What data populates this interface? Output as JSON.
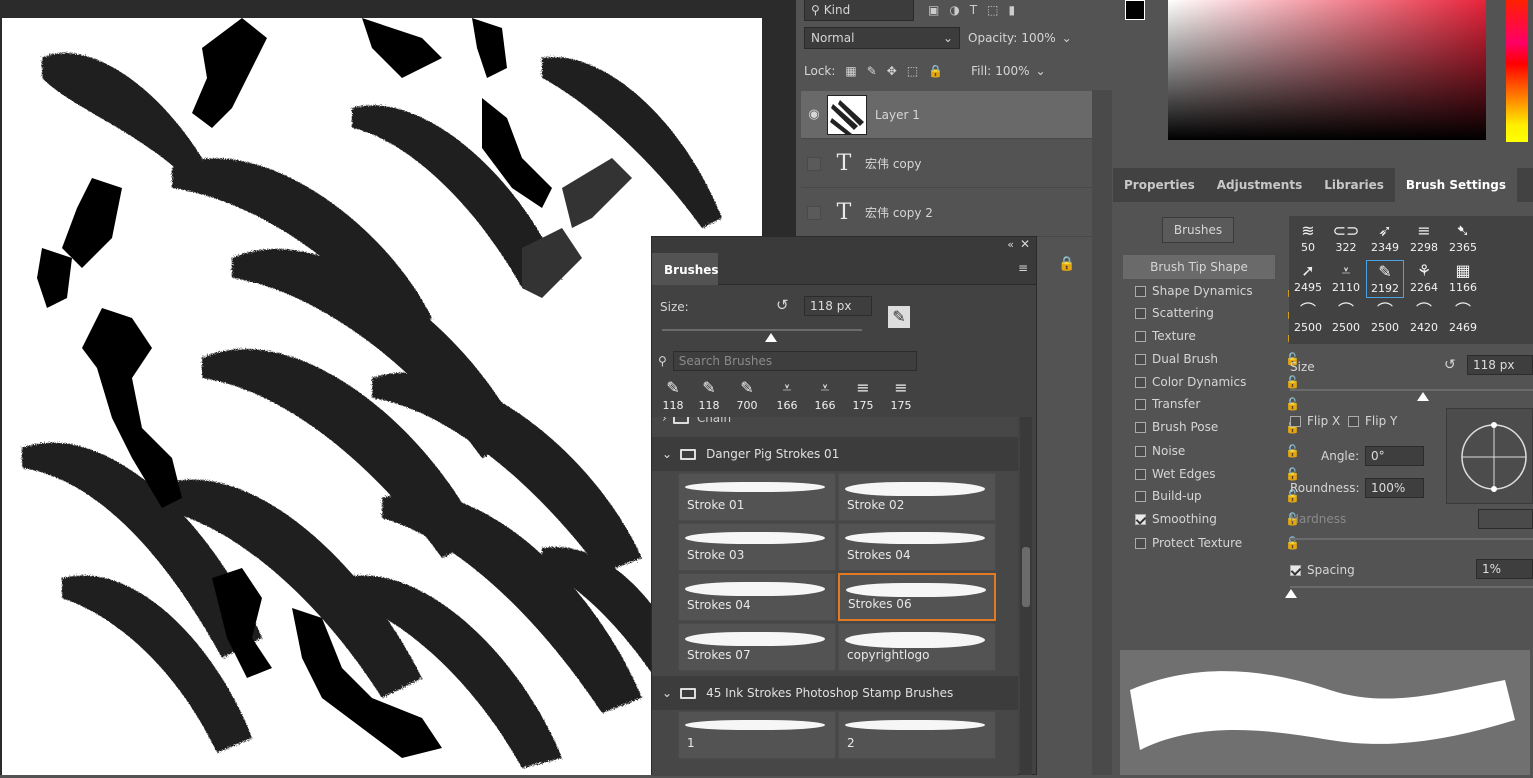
{
  "layers_panel": {
    "filter_kind": "Kind",
    "blend_mode": "Normal",
    "opacity_label": "Opacity:",
    "opacity_value": "100%",
    "lock_label": "Lock:",
    "fill_label": "Fill:",
    "fill_value": "100%",
    "layers": [
      {
        "name": "Layer 1",
        "type": "pixel",
        "visible": true,
        "active": true
      },
      {
        "name": "宏伟 copy",
        "type": "text",
        "visible": false,
        "active": false
      },
      {
        "name": "宏伟 copy 2",
        "type": "text",
        "visible": false,
        "active": false
      }
    ]
  },
  "brush_settings": {
    "tabs": [
      "Properties",
      "Adjustments",
      "Libraries",
      "Brush Settings"
    ],
    "active_tab": "Brush Settings",
    "brushes_button": "Brushes",
    "tip_shape": "Brush Tip Shape",
    "options": [
      {
        "label": "Shape Dynamics",
        "checked": false
      },
      {
        "label": "Scattering",
        "checked": false
      },
      {
        "label": "Texture",
        "checked": false
      },
      {
        "label": "Dual Brush",
        "checked": false
      },
      {
        "label": "Color Dynamics",
        "checked": false
      },
      {
        "label": "Transfer",
        "checked": false
      },
      {
        "label": "Brush Pose",
        "checked": false
      },
      {
        "label": "Noise",
        "checked": false
      },
      {
        "label": "Wet Edges",
        "checked": false
      },
      {
        "label": "Build-up",
        "checked": false
      },
      {
        "label": "Smoothing",
        "checked": true
      },
      {
        "label": "Protect Texture",
        "checked": false
      }
    ],
    "tips": [
      "50",
      "322",
      "2349",
      "2298",
      "2365",
      "2495",
      "2110",
      "2192",
      "2264",
      "1166",
      "2500",
      "2500",
      "2500",
      "2420",
      "2469"
    ],
    "active_tip": "2192",
    "size_label": "Size",
    "size_value": "118 px",
    "flip_x": "Flip X",
    "flip_y": "Flip Y",
    "angle_label": "Angle:",
    "angle_value": "0°",
    "roundness_label": "Roundness:",
    "roundness_value": "100%",
    "hardness_label": "Hardness",
    "spacing_label": "Spacing",
    "spacing_value": "1%"
  },
  "brushes_panel": {
    "tab": "Brushes",
    "size_label": "Size:",
    "size_value": "118 px",
    "search_placeholder": "Search Brushes",
    "recent": [
      "118",
      "118",
      "700",
      "166",
      "166",
      "175",
      "175"
    ],
    "partial_group": "Chain",
    "groups": [
      {
        "name": "Danger Pig Strokes 01",
        "brushes": [
          "Stroke 01",
          "Stroke 02",
          "Stroke 03",
          "Strokes 04",
          "Strokes 04",
          "Strokes 06",
          "Strokes 07",
          "copyrightlogo"
        ]
      },
      {
        "name": "45 Ink Strokes Photoshop Stamp Brushes",
        "brushes": [
          "1",
          "2"
        ]
      }
    ],
    "active_brush": "Strokes 06"
  }
}
